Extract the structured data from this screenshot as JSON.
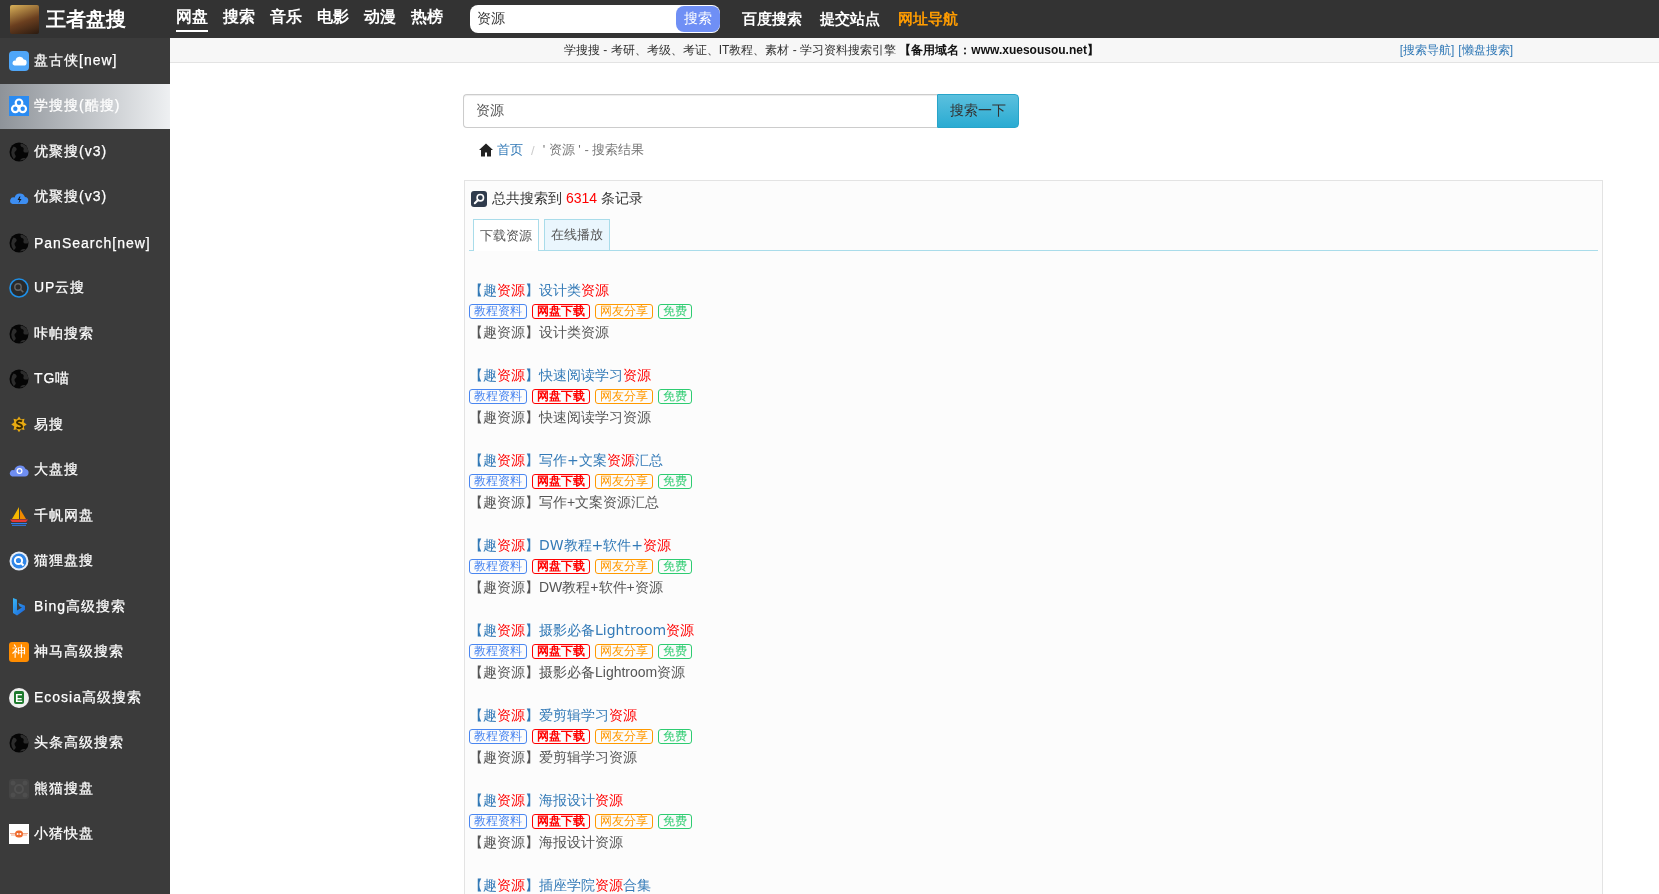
{
  "header": {
    "logo_text": "王者盘搜",
    "nav": [
      {
        "label": "网盘",
        "selected": true
      },
      {
        "label": "搜索",
        "selected": false
      },
      {
        "label": "音乐",
        "selected": false
      },
      {
        "label": "电影",
        "selected": false
      },
      {
        "label": "动漫",
        "selected": false
      },
      {
        "label": "热榜",
        "selected": false
      }
    ],
    "search": {
      "value": "资源",
      "button": "搜索"
    },
    "links": [
      {
        "label": "百度搜索",
        "highlight": false
      },
      {
        "label": "提交站点",
        "highlight": false
      },
      {
        "label": "网址导航",
        "highlight": true
      }
    ]
  },
  "sidebar": {
    "items": [
      {
        "label": "盘古侠[new]",
        "selected": false
      },
      {
        "label": "学搜搜(酷搜)",
        "selected": true
      },
      {
        "label": "优聚搜(v3)",
        "selected": false
      },
      {
        "label": "优聚搜(v3)",
        "selected": false
      },
      {
        "label": "PanSearch[new]",
        "selected": false
      },
      {
        "label": "UP云搜",
        "selected": false
      },
      {
        "label": "咔帕搜索",
        "selected": false
      },
      {
        "label": "TG喵",
        "selected": false
      },
      {
        "label": "易搜",
        "selected": false
      },
      {
        "label": "大盘搜",
        "selected": false
      },
      {
        "label": "千帆网盘",
        "selected": false
      },
      {
        "label": "猫狸盘搜",
        "selected": false
      },
      {
        "label": "Bing高级搜索",
        "selected": false
      },
      {
        "label": "神马高级搜索",
        "selected": false,
        "icon_text": "神"
      },
      {
        "label": "Ecosia高级搜索",
        "selected": false,
        "icon_text": "E"
      },
      {
        "label": "头条高级搜索",
        "selected": false
      },
      {
        "label": "熊猫搜盘",
        "selected": false
      },
      {
        "label": "小猪快盘",
        "selected": false
      }
    ]
  },
  "notice_bar": {
    "text": "学搜搜 - 考研、考级、考证、IT教程、素材 - 学习资料搜索引擎 **【备用域名：www.xuesousou.net】**",
    "links": [
      "[搜索导航]",
      "[懒盘搜索]"
    ]
  },
  "search": {
    "value": "资源",
    "button": "搜索一下"
  },
  "breadcrumb": {
    "home": "首页",
    "separator": "/",
    "current": "' 资源 ' - 搜索结果"
  },
  "results_panel": {
    "summary": {
      "before": "总共搜索到",
      "count": "6314",
      "after": "条记录"
    },
    "tabs": [
      {
        "label": "下载资源",
        "selected": true
      },
      {
        "label": "在线播放",
        "selected": false
      }
    ],
    "results": [
      {
        "title": [
          {
            "text": "【趣",
            "highlight": false
          },
          {
            "text": "资源",
            "highlight": true
          },
          {
            "text": "】设计类",
            "highlight": false
          },
          {
            "text": "资源",
            "highlight": true
          }
        ],
        "tags": [
          {
            "label": "教程资料",
            "color": "#4a86f0",
            "bold": false
          },
          {
            "label": "网盘下载",
            "color": "#ff0000",
            "bold": true
          },
          {
            "label": "网友分享",
            "color": "#ff9900",
            "bold": false
          },
          {
            "label": "免费",
            "color": "#2ecc71",
            "bold": false
          }
        ],
        "description": "【趣资源】设计类资源"
      },
      {
        "title": [
          {
            "text": "【趣",
            "highlight": false
          },
          {
            "text": "资源",
            "highlight": true
          },
          {
            "text": "】快速阅读学习",
            "highlight": false
          },
          {
            "text": "资源",
            "highlight": true
          }
        ],
        "tags": [
          {
            "label": "教程资料",
            "color": "#4a86f0",
            "bold": false
          },
          {
            "label": "网盘下载",
            "color": "#ff0000",
            "bold": true
          },
          {
            "label": "网友分享",
            "color": "#ff9900",
            "bold": false
          },
          {
            "label": "免费",
            "color": "#2ecc71",
            "bold": false
          }
        ],
        "description": "【趣资源】快速阅读学习资源"
      },
      {
        "title": [
          {
            "text": "【趣",
            "highlight": false
          },
          {
            "text": "资源",
            "highlight": true
          },
          {
            "text": "】写作+文案",
            "highlight": false
          },
          {
            "text": "资源",
            "highlight": true
          },
          {
            "text": "汇总",
            "highlight": false
          }
        ],
        "tags": [
          {
            "label": "教程资料",
            "color": "#4a86f0",
            "bold": false
          },
          {
            "label": "网盘下载",
            "color": "#ff0000",
            "bold": true
          },
          {
            "label": "网友分享",
            "color": "#ff9900",
            "bold": false
          },
          {
            "label": "免费",
            "color": "#2ecc71",
            "bold": false
          }
        ],
        "description": "【趣资源】写作+文案资源汇总"
      },
      {
        "title": [
          {
            "text": "【趣",
            "highlight": false
          },
          {
            "text": "资源",
            "highlight": true
          },
          {
            "text": "】DW教程+软件+",
            "highlight": false
          },
          {
            "text": "资源",
            "highlight": true
          }
        ],
        "tags": [
          {
            "label": "教程资料",
            "color": "#4a86f0",
            "bold": false
          },
          {
            "label": "网盘下载",
            "color": "#ff0000",
            "bold": true
          },
          {
            "label": "网友分享",
            "color": "#ff9900",
            "bold": false
          },
          {
            "label": "免费",
            "color": "#2ecc71",
            "bold": false
          }
        ],
        "description": "【趣资源】DW教程+软件+资源"
      },
      {
        "title": [
          {
            "text": "【趣",
            "highlight": false
          },
          {
            "text": "资源",
            "highlight": true
          },
          {
            "text": "】摄影必备Lightroom",
            "highlight": false
          },
          {
            "text": "资源",
            "highlight": true
          }
        ],
        "tags": [
          {
            "label": "教程资料",
            "color": "#4a86f0",
            "bold": false
          },
          {
            "label": "网盘下载",
            "color": "#ff0000",
            "bold": true
          },
          {
            "label": "网友分享",
            "color": "#ff9900",
            "bold": false
          },
          {
            "label": "免费",
            "color": "#2ecc71",
            "bold": false
          }
        ],
        "description": "【趣资源】摄影必备Lightroom资源"
      },
      {
        "title": [
          {
            "text": "【趣",
            "highlight": false
          },
          {
            "text": "资源",
            "highlight": true
          },
          {
            "text": "】爱剪辑学习",
            "highlight": false
          },
          {
            "text": "资源",
            "highlight": true
          }
        ],
        "tags": [
          {
            "label": "教程资料",
            "color": "#4a86f0",
            "bold": false
          },
          {
            "label": "网盘下载",
            "color": "#ff0000",
            "bold": true
          },
          {
            "label": "网友分享",
            "color": "#ff9900",
            "bold": false
          },
          {
            "label": "免费",
            "color": "#2ecc71",
            "bold": false
          }
        ],
        "description": "【趣资源】爱剪辑学习资源"
      },
      {
        "title": [
          {
            "text": "【趣",
            "highlight": false
          },
          {
            "text": "资源",
            "highlight": true
          },
          {
            "text": "】海报设计",
            "highlight": false
          },
          {
            "text": "资源",
            "highlight": true
          }
        ],
        "tags": [
          {
            "label": "教程资料",
            "color": "#4a86f0",
            "bold": false
          },
          {
            "label": "网盘下载",
            "color": "#ff0000",
            "bold": true
          },
          {
            "label": "网友分享",
            "color": "#ff9900",
            "bold": false
          },
          {
            "label": "免费",
            "color": "#2ecc71",
            "bold": false
          }
        ],
        "description": "【趣资源】海报设计资源"
      },
      {
        "title": [
          {
            "text": "【趣",
            "highlight": false
          },
          {
            "text": "资源",
            "highlight": true
          },
          {
            "text": "】插座学院",
            "highlight": false
          },
          {
            "text": "资源",
            "highlight": true
          },
          {
            "text": "合集",
            "highlight": false
          }
        ]
      }
    ]
  }
}
